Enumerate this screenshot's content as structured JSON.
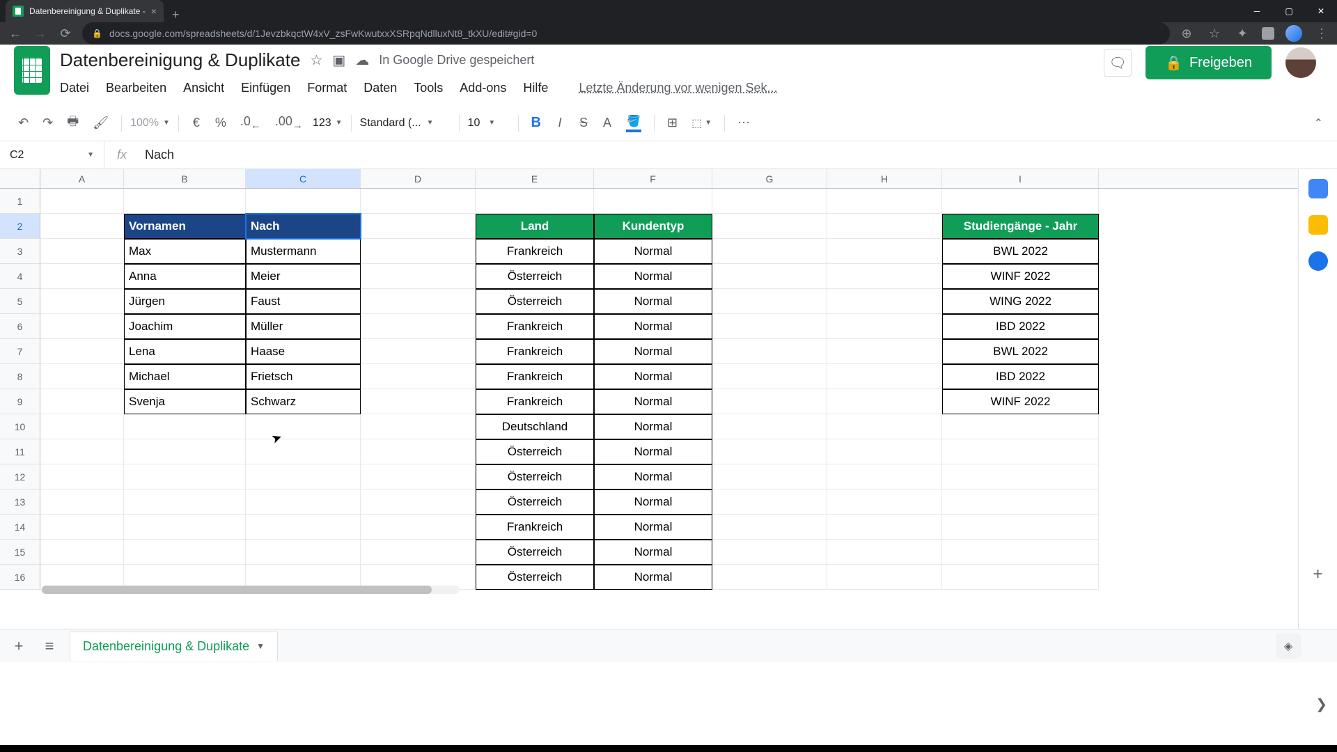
{
  "browser": {
    "tab_title": "Datenbereinigung & Duplikate -",
    "url": "docs.google.com/spreadsheets/d/1JevzbkqctW4xV_zsFwKwutxxXSRpqNdlluxNt8_tkXU/edit#gid=0"
  },
  "header": {
    "doc_title": "Datenbereinigung & Duplikate",
    "save_status": "In Google Drive gespeichert",
    "last_edit": "Letzte Änderung vor wenigen Sek...",
    "share_label": "Freigeben"
  },
  "menus": [
    "Datei",
    "Bearbeiten",
    "Ansicht",
    "Einfügen",
    "Format",
    "Daten",
    "Tools",
    "Add-ons",
    "Hilfe"
  ],
  "toolbar": {
    "zoom": "100%",
    "currency": "€",
    "percent": "%",
    "dec_less": ".0",
    "dec_more": ".00",
    "num_format": "123",
    "font": "Standard (...",
    "font_size": "10"
  },
  "formula": {
    "name_box": "C2",
    "value": "Nach"
  },
  "columns": [
    "A",
    "B",
    "C",
    "D",
    "E",
    "F",
    "G",
    "H",
    "I"
  ],
  "selected_column": "C",
  "selected_row": 2,
  "row_count": 16,
  "table1": {
    "headers": [
      "Vornamen",
      "Nach"
    ],
    "rows": [
      [
        "Max",
        "Mustermann"
      ],
      [
        "Anna",
        "Meier"
      ],
      [
        "Jürgen",
        "Faust"
      ],
      [
        "Joachim",
        "Müller"
      ],
      [
        "Lena",
        "Haase"
      ],
      [
        "Michael",
        "Frietsch"
      ],
      [
        "Svenja",
        "Schwarz"
      ]
    ]
  },
  "table2": {
    "headers": [
      "Land",
      "Kundentyp"
    ],
    "rows": [
      [
        "Frankreich",
        "Normal"
      ],
      [
        "Österreich",
        "Normal"
      ],
      [
        "Österreich",
        "Normal"
      ],
      [
        "Frankreich",
        "Normal"
      ],
      [
        "Frankreich",
        "Normal"
      ],
      [
        "Frankreich",
        "Normal"
      ],
      [
        "Frankreich",
        "Normal"
      ],
      [
        "Deutschland",
        "Normal"
      ],
      [
        "Österreich",
        "Normal"
      ],
      [
        "Österreich",
        "Normal"
      ],
      [
        "Österreich",
        "Normal"
      ],
      [
        "Frankreich",
        "Normal"
      ],
      [
        "Österreich",
        "Normal"
      ],
      [
        "Österreich",
        "Normal"
      ]
    ]
  },
  "table3": {
    "header": "Studiengänge - Jahr",
    "rows": [
      "BWL 2022",
      "WINF 2022",
      "WING 2022",
      "IBD 2022",
      "BWL 2022",
      "IBD 2022",
      "WINF 2022"
    ]
  },
  "sheet_tab": "Datenbereinigung & Duplikate"
}
